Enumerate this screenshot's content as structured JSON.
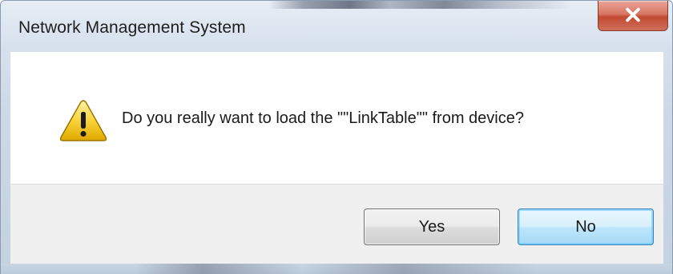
{
  "window": {
    "title": "Network Management System",
    "close_icon": "close-x-icon"
  },
  "dialog": {
    "icon": "warning-icon",
    "message": "Do you really want to load the \"\"LinkTable\"\" from device?"
  },
  "buttons": {
    "yes_label": "Yes",
    "no_label": "No"
  },
  "colors": {
    "close_button": "#c14a32",
    "default_button_border": "#3c7fb1",
    "warning_yellow": "#f5c518"
  }
}
